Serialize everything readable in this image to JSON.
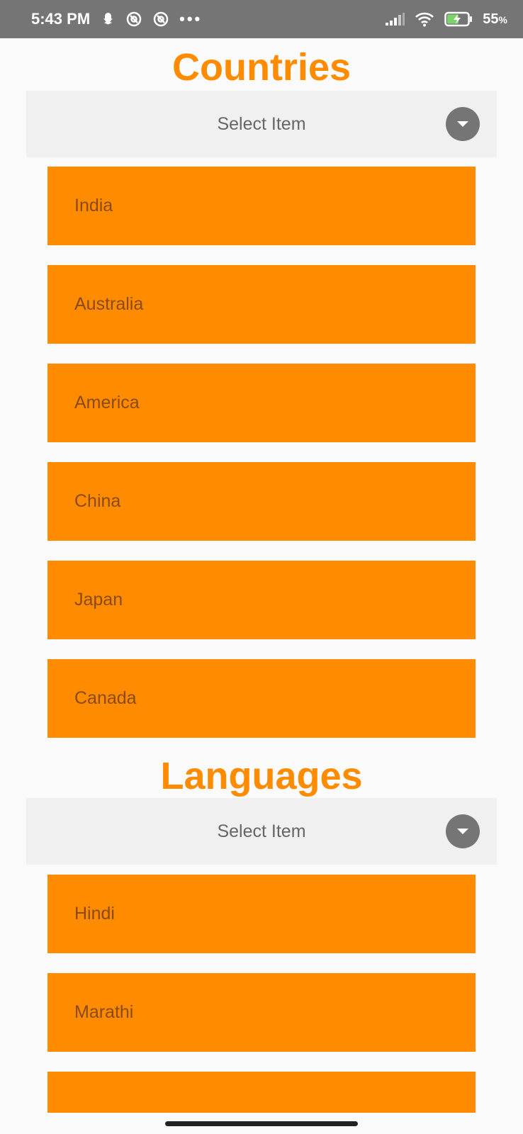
{
  "status_bar": {
    "time": "5:43 PM",
    "battery_percent": "55",
    "battery_unit": "%",
    "icons": [
      "snapchat-icon",
      "at-icon",
      "at-icon",
      "more-icon",
      "signal-icon",
      "wifi-icon",
      "battery-charging-icon"
    ]
  },
  "countries": {
    "title": "Countries",
    "dropdown_label": "Select Item",
    "items": [
      "India",
      "Australia",
      "America",
      "China",
      "Japan",
      "Canada"
    ]
  },
  "languages": {
    "title": "Languages",
    "dropdown_label": "Select Item",
    "items": [
      "Hindi",
      "Marathi",
      ""
    ]
  },
  "colors": {
    "accent": "#ff8c00",
    "item_text": "#8a4a15",
    "dropdown_bg": "#f0f0f0",
    "status_bar": "#757575"
  }
}
